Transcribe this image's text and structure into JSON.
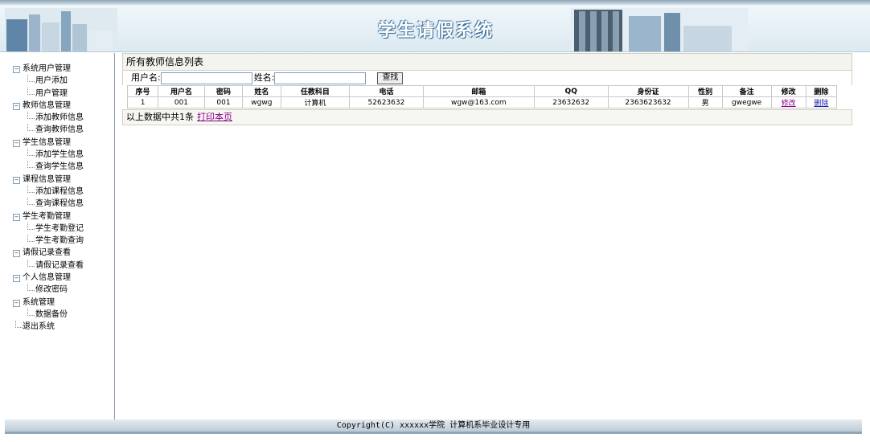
{
  "header": {
    "title": "学生请假系统"
  },
  "sidebar": {
    "groups": [
      {
        "label": "系统用户管理",
        "children": [
          "用户添加",
          "用户管理"
        ]
      },
      {
        "label": "教师信息管理",
        "children": [
          "添加教师信息",
          "查询教师信息"
        ]
      },
      {
        "label": "学生信息管理",
        "children": [
          "添加学生信息",
          "查询学生信息"
        ]
      },
      {
        "label": "课程信息管理",
        "children": [
          "添加课程信息",
          "查询课程信息"
        ]
      },
      {
        "label": "学生考勤管理",
        "children": [
          "学生考勤登记",
          "学生考勤查询"
        ]
      },
      {
        "label": "请假记录查看",
        "children": [
          "请假记录查看"
        ]
      },
      {
        "label": "个人信息管理",
        "children": [
          "修改密码"
        ]
      },
      {
        "label": "系统管理",
        "children": [
          "数据备份"
        ]
      }
    ],
    "exit": "退出系统"
  },
  "main": {
    "panel_title": "所有教师信息列表",
    "search": {
      "username_label": "用户名:",
      "name_label": "姓名:",
      "username_value": "",
      "name_value": "",
      "button": "查找"
    },
    "table": {
      "headers": [
        "序号",
        "用户名",
        "密码",
        "姓名",
        "任教科目",
        "电话",
        "邮箱",
        "QQ",
        "身份证",
        "性别",
        "备注",
        "修改",
        "删除"
      ],
      "rows": [
        [
          "1",
          "001",
          "001",
          "wgwg",
          "计算机",
          "52623632",
          "wgw@163.com",
          "23632632",
          "2363623632",
          "男",
          "gwegwe",
          "修改",
          "删除"
        ]
      ]
    },
    "summary": "以上数据中共1条",
    "print_link": "打印本页"
  },
  "footer": {
    "copyright": "Copyright(C) xxxxxx学院 计算机系毕业设计专用"
  },
  "colors": {
    "accent": "#3a6f9a",
    "link": "#8a008a",
    "delete_link": "#1a1aaa"
  }
}
